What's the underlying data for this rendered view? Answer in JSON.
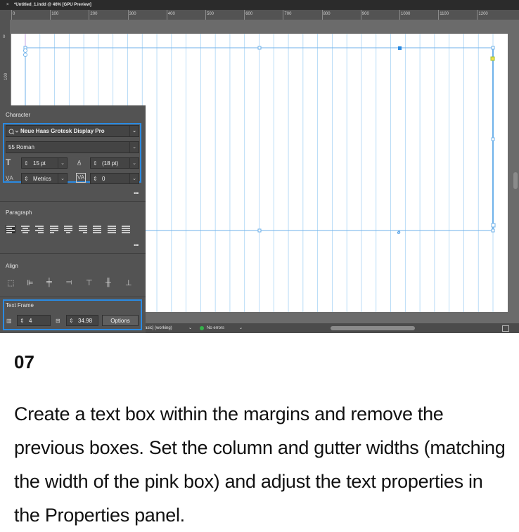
{
  "window": {
    "close_glyph": "×",
    "doc_title": "*Untitled_1.indd @ 46% [GPU Preview]"
  },
  "ruler": {
    "labels": [
      "100",
      "200",
      "300",
      "400",
      "500",
      "600",
      "700",
      "800",
      "900",
      "1000",
      "1100",
      "1200"
    ],
    "vertical_labels": [
      "0",
      "100"
    ]
  },
  "character": {
    "title": "Character",
    "font_family": "Neue Haas Grotesk Display Pro",
    "font_style": "55 Roman",
    "font_size": "15 pt",
    "leading": "(18 pt)",
    "kerning": "Metrics",
    "tracking": "0",
    "more": "•••"
  },
  "paragraph": {
    "title": "Paragraph",
    "more": "•••"
  },
  "align": {
    "title": "Align"
  },
  "text_frame": {
    "title": "Text Frame",
    "columns": "4",
    "gutter": "34.98",
    "options_label": "Options"
  },
  "status": {
    "profile": "asic] (working)",
    "errors": "No errors"
  },
  "step": {
    "number": "07",
    "text": "Create a text box within the margins and remove the previous boxes. Set the column and gutter widths (matching the width of the pink box) and adjust the text properties in the Properties panel."
  },
  "colors": {
    "guide": "#a9d4f5",
    "selection": "#2a8ae2",
    "panel": "#535353",
    "accent": "#2a8ae2"
  },
  "icons": {
    "search": "search-icon",
    "font_size": "font-size-icon",
    "leading": "leading-icon",
    "kerning": "kerning-icon",
    "tracking": "tracking-icon",
    "columns": "columns-icon",
    "gutter": "gutter-icon"
  }
}
